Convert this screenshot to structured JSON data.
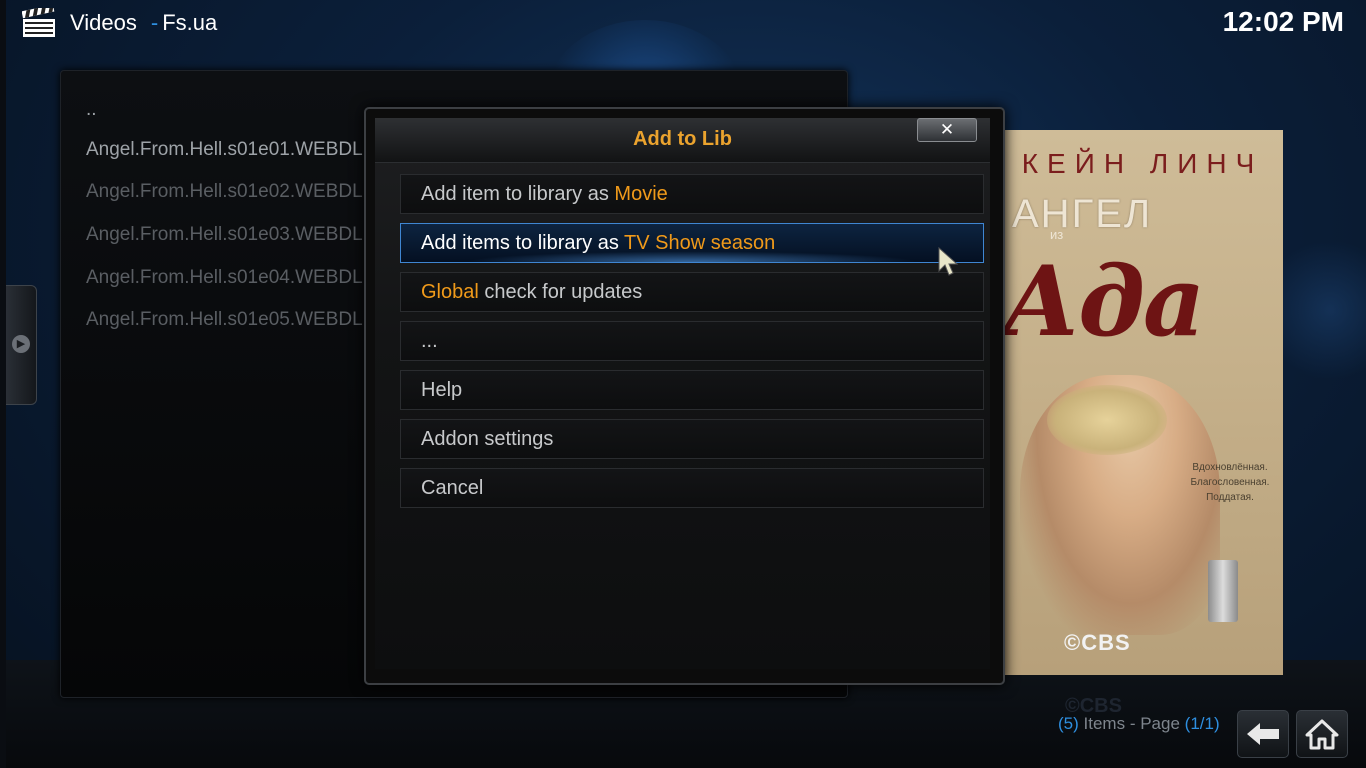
{
  "header": {
    "title": "Videos",
    "separator": "-",
    "subtitle": "Fs.ua",
    "clock": "12:02 PM"
  },
  "list": {
    "items": [
      "..",
      "Angel.From.Hell.s01e01.WEBDL",
      "Angel.From.Hell.s01e02.WEBDL",
      "Angel.From.Hell.s01e03.WEBDL",
      "Angel.From.Hell.s01e04.WEBDL",
      "Angel.From.Hell.s01e05.WEBDL"
    ]
  },
  "poster": {
    "actor": "КЕЙН ЛИНЧ",
    "title_line1": "АНГЕЛ",
    "title_small": "из",
    "title_line2": "Ада",
    "tagline": [
      "Вдохновлённая.",
      "Благословенная.",
      "Поддатая."
    ],
    "network": "©CBS"
  },
  "dialog": {
    "title": "Add to Lib",
    "close_label": "✕",
    "items": [
      {
        "prefix": "Add item to library as ",
        "accent": "Movie",
        "suffix": ""
      },
      {
        "prefix": "Add items to library as ",
        "accent": "TV Show season",
        "suffix": ""
      },
      {
        "prefix": "",
        "accent": "Global",
        "suffix": " check for updates"
      },
      {
        "prefix": "...",
        "accent": "",
        "suffix": ""
      },
      {
        "prefix": "Help",
        "accent": "",
        "suffix": ""
      },
      {
        "prefix": "Addon settings",
        "accent": "",
        "suffix": ""
      },
      {
        "prefix": "Cancel",
        "accent": "",
        "suffix": ""
      }
    ],
    "focused_index": 1
  },
  "footer": {
    "count_open": "(",
    "count": "5",
    "count_close": ")",
    "items_label": " Items - Page ",
    "page_open": "(",
    "page": "1/1",
    "page_close": ")"
  },
  "colors": {
    "accent_orange": "#f09a1a",
    "title_orange": "#eba32e",
    "highlight_blue": "#2e8fe0"
  },
  "icons": {
    "header": "clapperboard-icon",
    "side_tab": "chevron-right-icon",
    "back": "back-arrow-icon",
    "home": "home-icon",
    "cursor": "mouse-pointer-icon"
  }
}
